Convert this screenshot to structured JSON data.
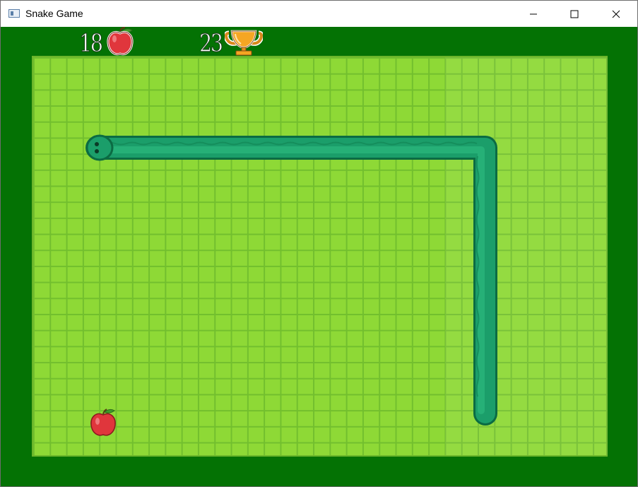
{
  "window": {
    "title": "Snake Game",
    "minimize_icon": "minimize-icon",
    "maximize_icon": "maximize-icon",
    "close_icon": "close-icon"
  },
  "hud": {
    "score": "18",
    "score_icon": "apple-icon",
    "best_score": "23",
    "best_icon": "trophy-icon"
  },
  "board": {
    "food_icon": "apple-icon",
    "snake_direction": "left",
    "colors": {
      "background": "#047204",
      "grass": "#8ed936",
      "grid_line": "#72bf2e",
      "snake": "#1b9e6a",
      "apple": "#e0363c"
    }
  }
}
